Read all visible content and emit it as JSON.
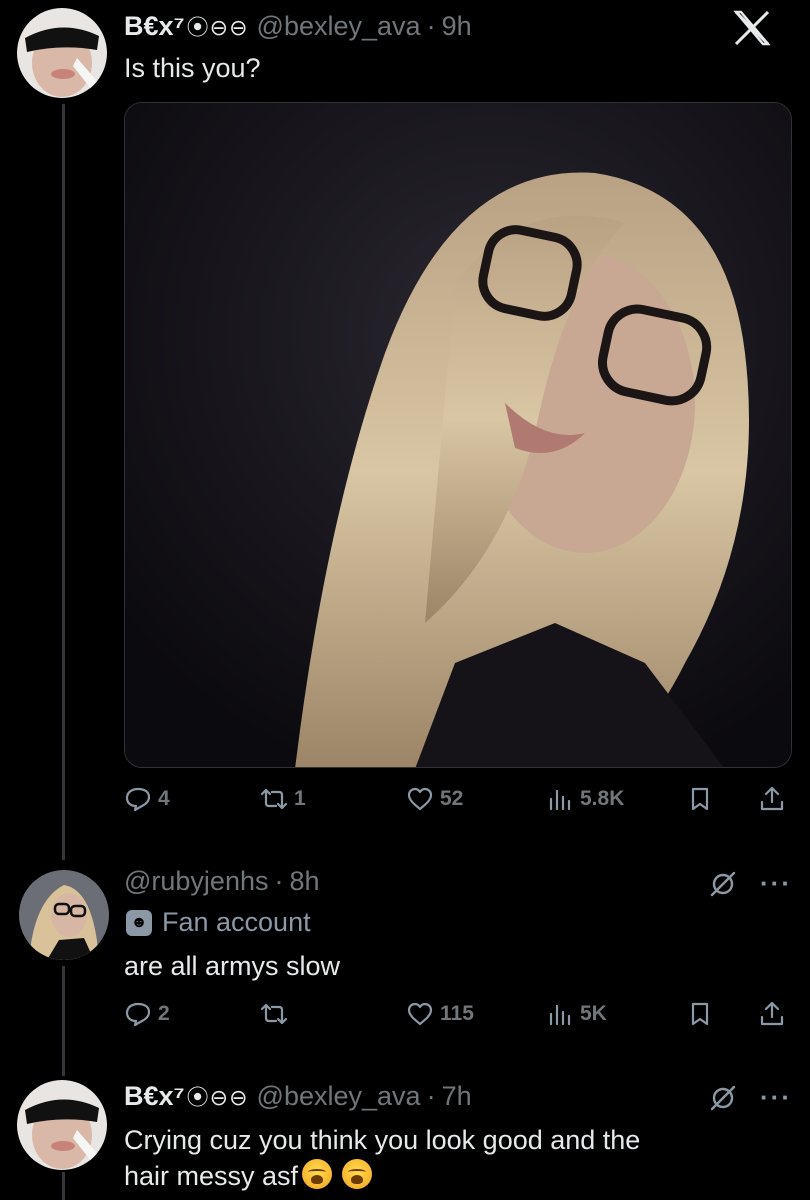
{
  "tweet1": {
    "name": "B€x⁷",
    "name_deco": "⦿⊖⊖",
    "handle": "@bexley_ava",
    "dot": "·",
    "time": "9h",
    "text": "Is this you?",
    "actions": {
      "replies": "4",
      "reposts": "1",
      "likes": "52",
      "views": "5.8K"
    }
  },
  "tweet2": {
    "handle": "@rubyjenhs",
    "dot": "·",
    "time": "8h",
    "badge_label": "Fan account",
    "text": "are all armys slow",
    "more": "···",
    "actions": {
      "replies": "2",
      "reposts": "",
      "likes": "115",
      "views": "5K"
    }
  },
  "tweet3": {
    "name": "B€x⁷",
    "name_deco": "⦿⊖⊖",
    "handle": "@bexley_ava",
    "dot": "·",
    "time": "7h",
    "text_line1": "Crying cuz you think you look good and the",
    "text_line2": "hair messy asf",
    "more": "···"
  },
  "icons": {
    "app_logo": "x-logo-icon",
    "reply": "reply-icon",
    "repost": "repost-icon",
    "like": "heart-icon",
    "views": "views-icon",
    "bookmark": "bookmark-icon",
    "share": "share-icon",
    "grok": "grok-icon",
    "badge": "mask-icon",
    "emoji": "loudly-crying-face-emoji"
  },
  "colors": {
    "background": "#000000",
    "text_primary": "#e7e9ea",
    "text_secondary": "#71767b",
    "thread_line": "#333639"
  }
}
